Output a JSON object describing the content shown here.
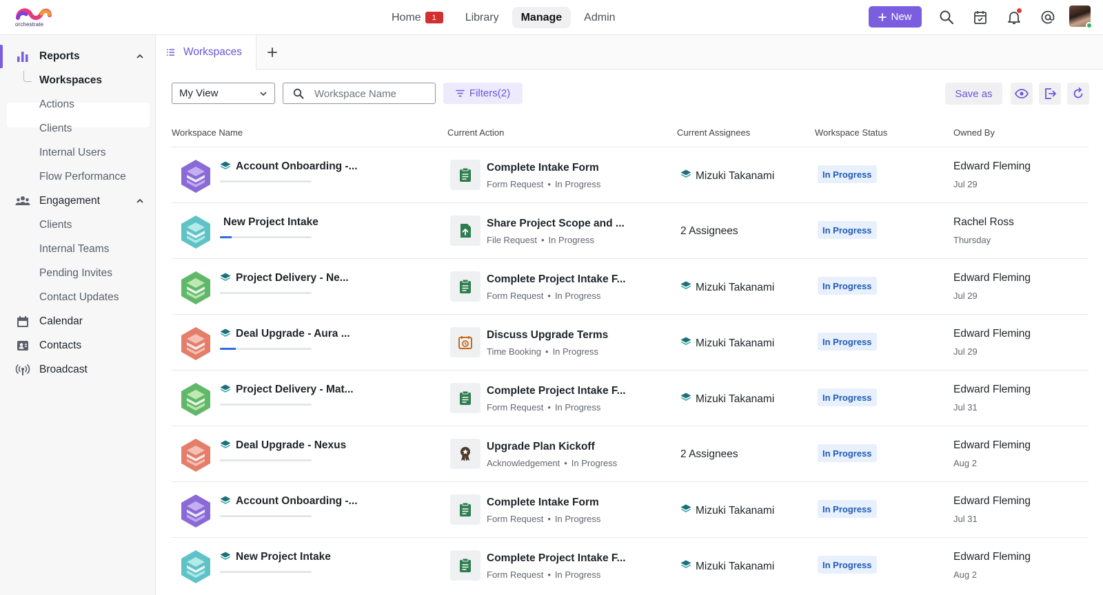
{
  "app": {
    "logo_text": "orchestrate"
  },
  "nav": {
    "items": [
      {
        "label": "Home",
        "badge": "1"
      },
      {
        "label": "Library"
      },
      {
        "label": "Manage",
        "active": true
      },
      {
        "label": "Admin"
      }
    ],
    "new_button": "New",
    "icons": [
      "search-icon",
      "calendar-check-icon",
      "bell-icon",
      "at-icon",
      "avatar"
    ]
  },
  "sidebar": {
    "sections": [
      {
        "label": "Reports",
        "icon": "bar-chart-icon",
        "expanded": true,
        "items": [
          "Workspaces",
          "Actions",
          "Clients",
          "Internal Users",
          "Flow Performance"
        ],
        "selected": "Workspaces"
      },
      {
        "label": "Engagement",
        "icon": "people-icon",
        "expanded": true,
        "items": [
          "Clients",
          "Internal Teams",
          "Pending Invites",
          "Contact Updates"
        ]
      },
      {
        "label": "Calendar",
        "icon": "calendar-icon"
      },
      {
        "label": "Contacts",
        "icon": "contacts-icon"
      },
      {
        "label": "Broadcast",
        "icon": "broadcast-icon"
      }
    ]
  },
  "tabs": {
    "active": "Workspaces",
    "add_label": "+"
  },
  "toolbar": {
    "view": "My View",
    "search_placeholder": "Workspace Name",
    "filters": "Filters(2)",
    "save_as": "Save as"
  },
  "table": {
    "headers": [
      "Workspace Name",
      "Current Action",
      "Current Assignees",
      "Workspace Status",
      "Owned By"
    ],
    "rows": [
      {
        "name": "Account Onboarding -...",
        "hex": "purple",
        "progress": 0,
        "show_icon": true,
        "action": "Complete Intake Form",
        "action_type": "Form Request",
        "action_status": "In Progress",
        "action_icon": "clipboard-icon",
        "assignees": "Mizuki Takanami",
        "assignee_icon": true,
        "status": "In Progress",
        "owner": "Edward Fleming",
        "date": "Jul 29"
      },
      {
        "name": "New Project Intake",
        "hex": "teal",
        "progress": 0.13,
        "show_icon": false,
        "action": "Share Project Scope and ...",
        "action_type": "File Request",
        "action_status": "In Progress",
        "action_icon": "file-upload-icon",
        "assignees": "2 Assignees",
        "assignee_icon": false,
        "status": "In Progress",
        "owner": "Rachel Ross",
        "date": "Thursday"
      },
      {
        "name": "Project Delivery - Ne...",
        "hex": "green",
        "progress": 0,
        "show_icon": true,
        "action": "Complete Project Intake F...",
        "action_type": "Form Request",
        "action_status": "In Progress",
        "action_icon": "clipboard-icon",
        "assignees": "Mizuki Takanami",
        "assignee_icon": true,
        "status": "In Progress",
        "owner": "Edward Fleming",
        "date": "Jul 29"
      },
      {
        "name": "Deal Upgrade - Aura ...",
        "hex": "coral",
        "progress": 0.17,
        "show_icon": true,
        "action": "Discuss Upgrade Terms",
        "action_type": "Time Booking",
        "action_status": "In Progress",
        "action_icon": "calendar-booking-icon",
        "assignees": "Mizuki Takanami",
        "assignee_icon": true,
        "status": "In Progress",
        "owner": "Edward Fleming",
        "date": "Jul 29"
      },
      {
        "name": "Project Delivery - Mat...",
        "hex": "green",
        "progress": 0,
        "show_icon": true,
        "action": "Complete Project Intake F...",
        "action_type": "Form Request",
        "action_status": "In Progress",
        "action_icon": "clipboard-icon",
        "assignees": "Mizuki Takanami",
        "assignee_icon": true,
        "status": "In Progress",
        "owner": "Edward Fleming",
        "date": "Jul 31"
      },
      {
        "name": "Deal Upgrade - Nexus",
        "hex": "coral",
        "progress": 0,
        "show_icon": true,
        "action": "Upgrade Plan Kickoff",
        "action_type": "Acknowledgement",
        "action_status": "In Progress",
        "action_icon": "award-icon",
        "assignees": "2 Assignees",
        "assignee_icon": false,
        "status": "In Progress",
        "owner": "Edward Fleming",
        "date": "Aug 2"
      },
      {
        "name": "Account Onboarding -...",
        "hex": "purple",
        "progress": 0,
        "show_icon": true,
        "action": "Complete Intake Form",
        "action_type": "Form Request",
        "action_status": "In Progress",
        "action_icon": "clipboard-icon",
        "assignees": "Mizuki Takanami",
        "assignee_icon": true,
        "status": "In Progress",
        "owner": "Edward Fleming",
        "date": "Jul 31"
      },
      {
        "name": "New Project Intake",
        "hex": "teal",
        "progress": 0,
        "show_icon": true,
        "action": "Complete Project Intake F...",
        "action_type": "Form Request",
        "action_status": "In Progress",
        "action_icon": "clipboard-icon",
        "assignees": "Mizuki Takanami",
        "assignee_icon": true,
        "status": "In Progress",
        "owner": "Edward Fleming",
        "date": "Aug 2"
      }
    ]
  },
  "colors": {
    "accent": "#7b5de0",
    "status_bg": "#e8f0fe",
    "status_text": "#1f5bb5",
    "hex": {
      "purple": [
        "#8a6ad6",
        "#c7b3f2"
      ],
      "teal": [
        "#5fc3c6",
        "#b8ecec"
      ],
      "green": [
        "#62b86a",
        "#c4ebb5"
      ],
      "coral": [
        "#e47d6a",
        "#f6c5b8"
      ]
    }
  }
}
